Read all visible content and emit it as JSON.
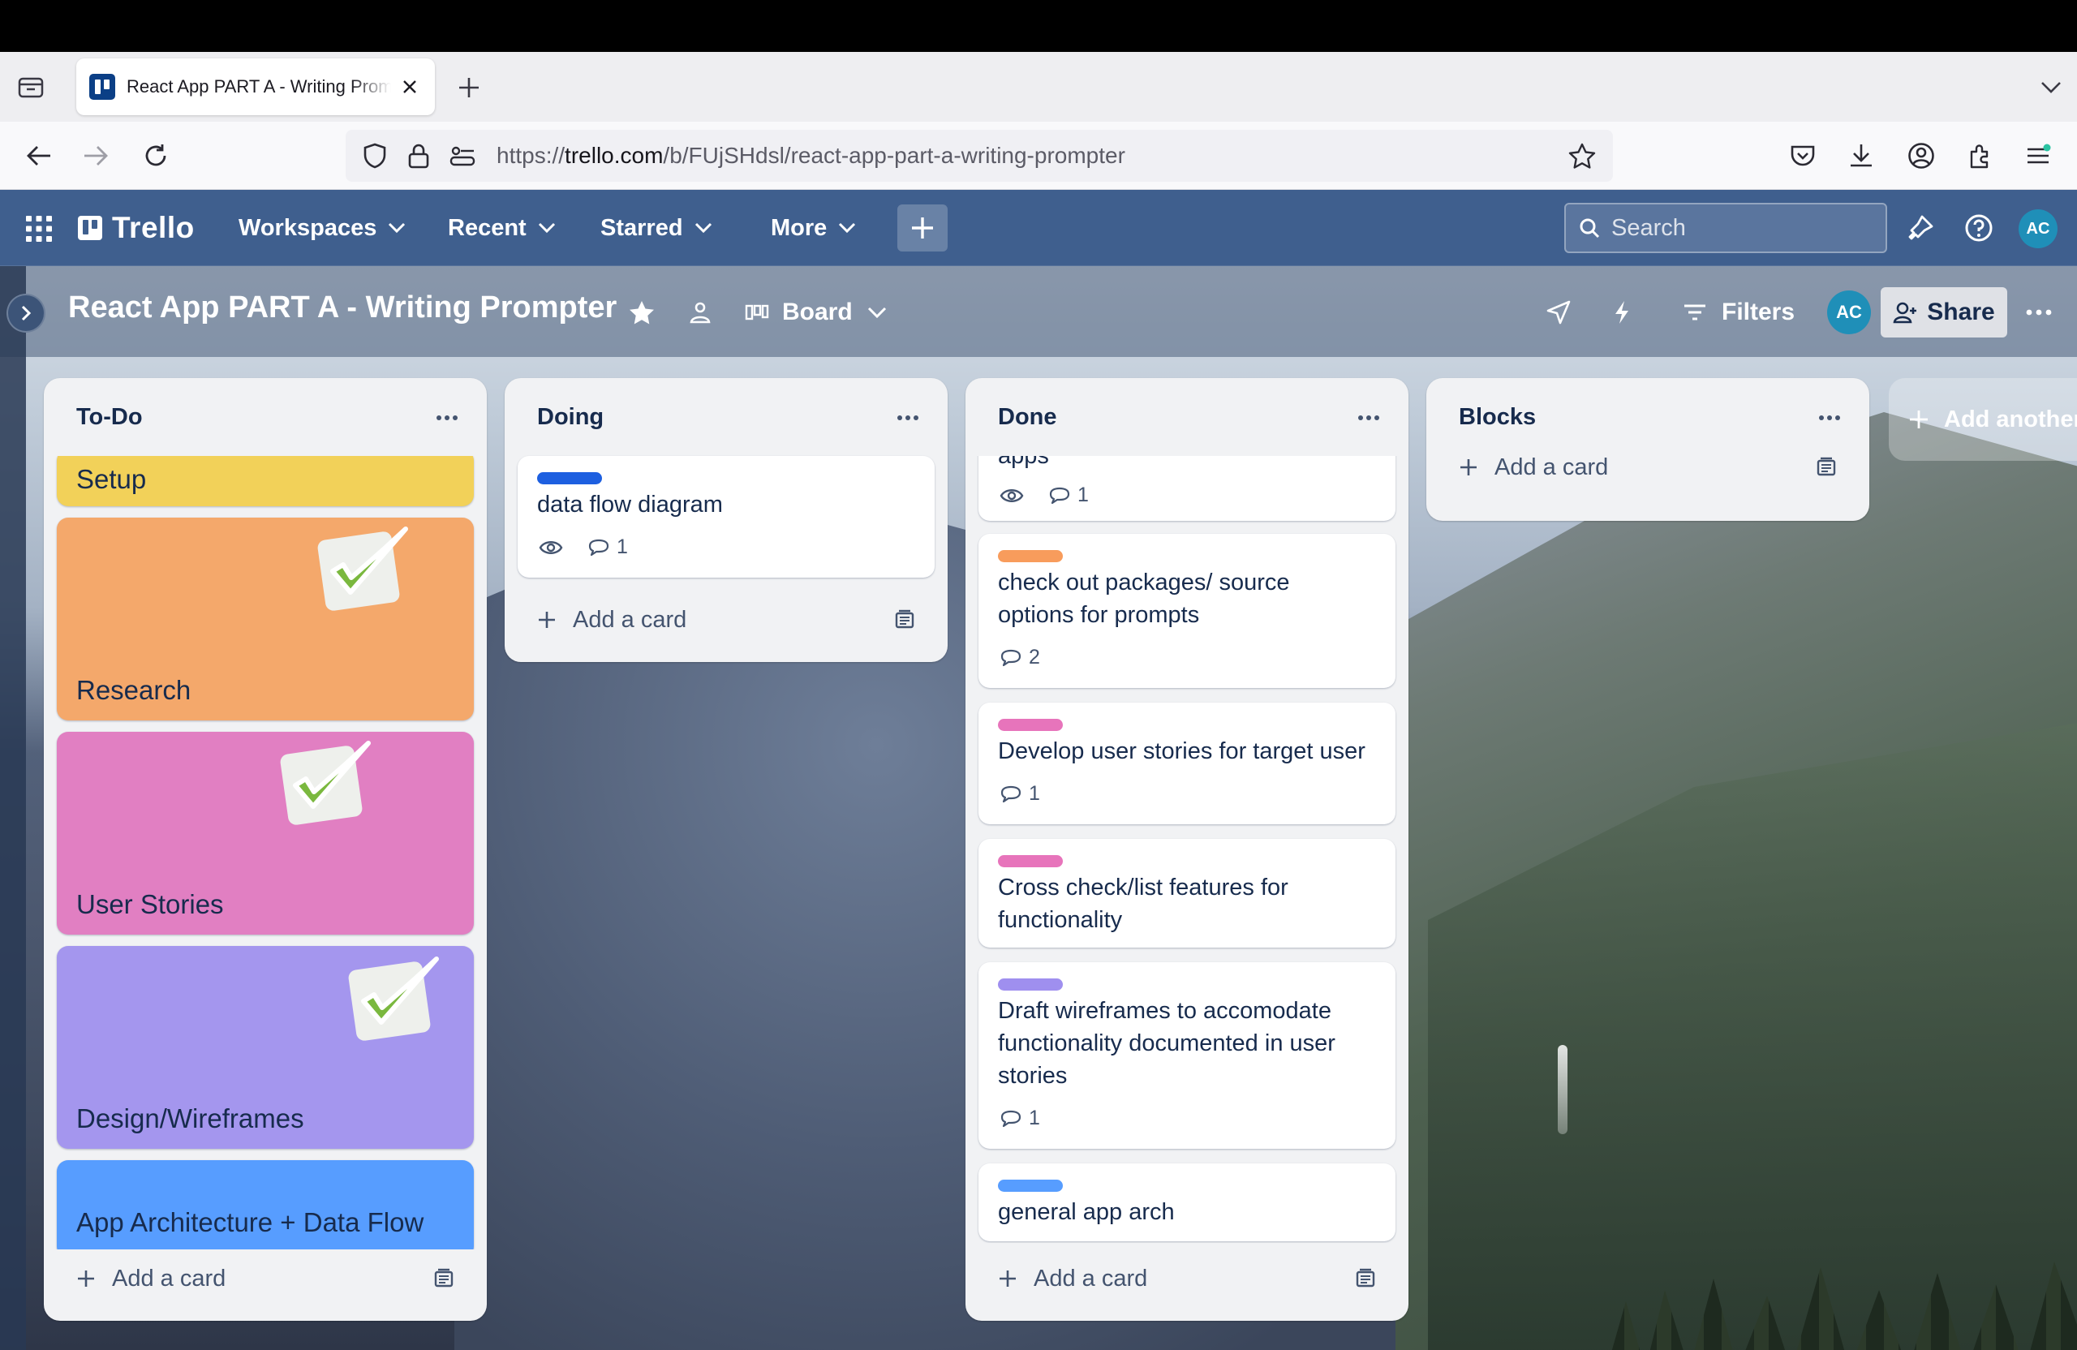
{
  "browser": {
    "tab_title": "React App PART A - Writing Prompter",
    "url_prefix": "https://",
    "url_domain": "trello.com",
    "url_path": "/b/FUjSHdsl/react-app-part-a-writing-prompter"
  },
  "header": {
    "logo": "Trello",
    "menus": [
      "Workspaces",
      "Recent",
      "Starred",
      "More"
    ],
    "search_placeholder": "Search",
    "avatar_initials": "AC"
  },
  "board": {
    "title": "React App PART A - Writing Prompter",
    "view": "Board",
    "filters_label": "Filters",
    "share_label": "Share",
    "member_initials": "AC",
    "add_list_label": "Add another list"
  },
  "lists": [
    {
      "title": "To-Do",
      "add_card": "Add a card",
      "cards": [
        {
          "title": "Setup",
          "cover": "#f2d159"
        },
        {
          "title": "Research",
          "cover": "#f4a86b"
        },
        {
          "title": "User Stories",
          "cover": "#e17fc2"
        },
        {
          "title": "Design/Wireframes",
          "cover": "#a496ee"
        },
        {
          "title": "App Architecture + Data Flow",
          "cover": "#579dff"
        }
      ]
    },
    {
      "title": "Doing",
      "add_card": "Add a card",
      "cards": [
        {
          "title": "data flow diagram",
          "label_color": "#1d5fe0",
          "comments": "1",
          "watching": true
        }
      ]
    },
    {
      "title": "Done",
      "add_card": "Add a card",
      "cards": [
        {
          "title": "apps",
          "comments": "1",
          "watching": true
        },
        {
          "title_line1": "check out packages/ source",
          "title_line2": "options for prompts",
          "label_color": "#f89c5c",
          "comments": "2"
        },
        {
          "title": "Develop user stories for target user",
          "label_color": "#e774bb",
          "comments": "1"
        },
        {
          "title_line1": "Cross check/list features for",
          "title_line2": "functionality",
          "label_color": "#e774bb"
        },
        {
          "title_line1": "Draft wireframes to accomodate",
          "title_line2": "functionality documented in user",
          "title_line3": "stories",
          "label_color": "#9f8fef",
          "comments": "1"
        },
        {
          "title": "general app arch",
          "label_color": "#579dff"
        }
      ]
    },
    {
      "title": "Blocks",
      "add_card": "Add a card",
      "cards": []
    }
  ],
  "colors": {
    "trello_header": "#3f5f8e",
    "list_bg": "#f1f2f4",
    "text": "#172b4d"
  },
  "icons": {
    "tab_list": "tab-list-icon",
    "back": "back-arrow-icon",
    "forward": "forward-arrow-icon",
    "reload": "reload-icon",
    "shield": "shield-icon",
    "lock": "lock-icon",
    "bookmark": "star-icon",
    "pocket": "pocket-icon",
    "downloads": "download-icon",
    "account": "account-icon",
    "extensions": "extensions-icon",
    "app_menu": "hamburger-icon"
  }
}
